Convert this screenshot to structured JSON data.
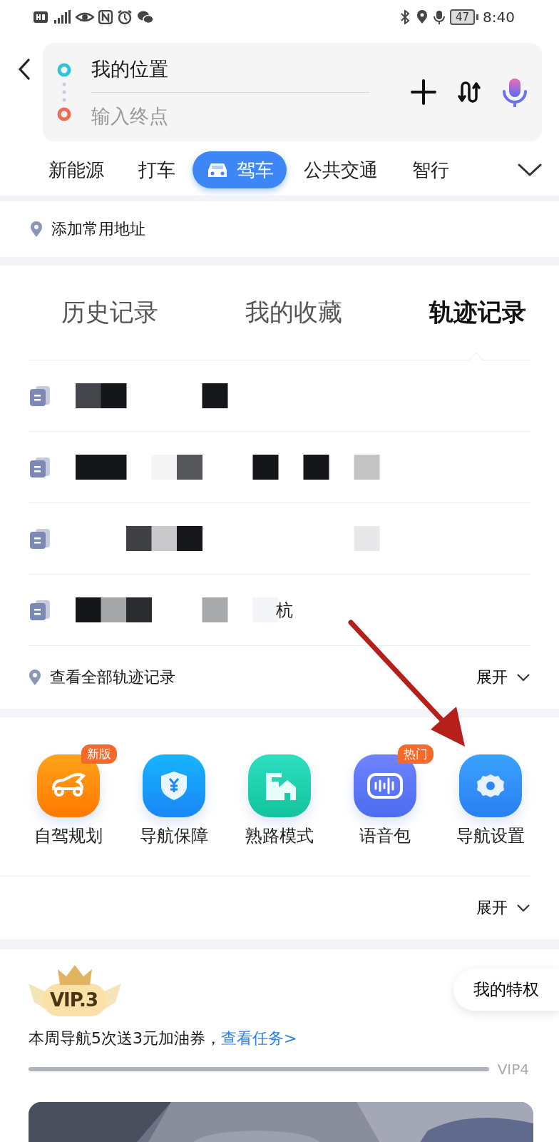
{
  "status_bar": {
    "battery": "47",
    "time": "8:40"
  },
  "route": {
    "origin": "我的位置",
    "destination": {
      "placeholder": "输入终点"
    }
  },
  "mode_tabs": [
    {
      "label": "新能源",
      "selected": false
    },
    {
      "label": "打车",
      "selected": false
    },
    {
      "label": "驾车",
      "selected": true
    },
    {
      "label": "公共交通",
      "selected": false
    },
    {
      "label": "智行",
      "selected": false
    }
  ],
  "common_address": {
    "label": "添加常用地址"
  },
  "records": {
    "tabs": [
      {
        "label": "历史记录",
        "selected": false
      },
      {
        "label": "我的收藏",
        "selected": false
      },
      {
        "label": "轨迹记录",
        "selected": true
      }
    ],
    "rows": [
      {
        "kind": "redacted"
      },
      {
        "kind": "redacted"
      },
      {
        "kind": "redacted"
      },
      {
        "kind": "redacted",
        "tail": "杭"
      }
    ],
    "footer": {
      "label": "查看全部轨迹记录",
      "toggle": "展开"
    }
  },
  "tools": {
    "items": [
      {
        "label": "自驾规划",
        "badge": "新版",
        "kind": "car"
      },
      {
        "label": "导航保障",
        "kind": "shield"
      },
      {
        "label": "熟路模式",
        "kind": "house"
      },
      {
        "label": "语音包",
        "badge": "热门",
        "kind": "voice"
      },
      {
        "label": "导航设置",
        "kind": "gear"
      }
    ],
    "toggle": "展开"
  },
  "vip": {
    "level_badge": "VIP.3",
    "privilege_button": "我的特权",
    "task_text": "本周导航5次送3元加油券，",
    "task_link": "查看任务>",
    "progress": {
      "level": 1
    },
    "next_level": "VIP4"
  }
}
